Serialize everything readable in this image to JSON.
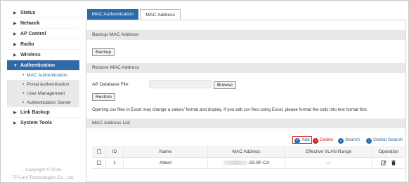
{
  "sidebar": {
    "items": [
      {
        "label": "Status"
      },
      {
        "label": "Network"
      },
      {
        "label": "AP Control"
      },
      {
        "label": "Radio"
      },
      {
        "label": "Wireless"
      },
      {
        "label": "Authentication",
        "active": true
      },
      {
        "label": "Link Backup"
      },
      {
        "label": "System Tools"
      }
    ],
    "sub_items": [
      {
        "label": "MAC Authentication",
        "current": true
      },
      {
        "label": "Portal Authentication"
      },
      {
        "label": "User Management"
      },
      {
        "label": "Authentication Server"
      }
    ],
    "copyright_line1": "Copyright © 2016",
    "copyright_line2": "TP-Link Technologies Co., Ltd."
  },
  "tabs": [
    {
      "label": "MAC Authentication",
      "active": true
    },
    {
      "label": "MAC Address",
      "active": false
    }
  ],
  "backup": {
    "header": "Backup MAC Address",
    "button": "Backup"
  },
  "restore": {
    "header": "Restore MAC Address",
    "file_label": "AP Database File:",
    "file_value": "",
    "browse_button": "Browse",
    "restore_button": "Restore",
    "note": "Opening csv files in Excel may change a values' format and display. If you edit csv files using Excel, please format the cells into text format first."
  },
  "list": {
    "header": "MAC Address List",
    "toolbar": {
      "add": "Add",
      "delete": "Delete",
      "search": "Search",
      "global_search": "Global Search"
    },
    "columns": {
      "id": "ID",
      "name": "Name",
      "mac": "MAC Address",
      "vlan": "Effective VLAN Range",
      "operation": "Operation"
    },
    "rows": [
      {
        "id": "1",
        "name": "Albert",
        "mac_visible": "-33-9F-CA",
        "vlan": "---"
      }
    ]
  },
  "colors": {
    "accent": "#2f6aa8",
    "delete": "#d0281e",
    "highlight_box": "#d0281e"
  },
  "icons": {
    "add": "add-icon",
    "delete": "delete-icon",
    "search": "search-icon",
    "global_search": "global-search-icon",
    "edit": "edit-icon",
    "trash": "trash-icon"
  }
}
